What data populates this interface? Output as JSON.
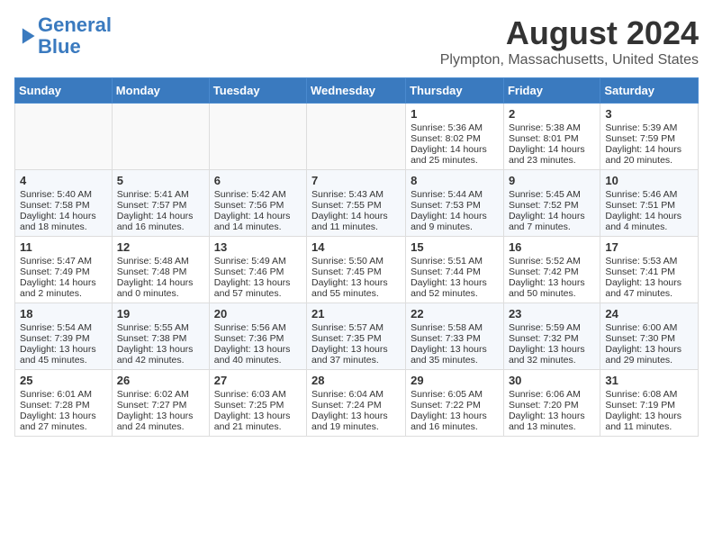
{
  "header": {
    "logo_line1": "General",
    "logo_line2": "Blue",
    "month_title": "August 2024",
    "location": "Plympton, Massachusetts, United States"
  },
  "weekdays": [
    "Sunday",
    "Monday",
    "Tuesday",
    "Wednesday",
    "Thursday",
    "Friday",
    "Saturday"
  ],
  "weeks": [
    [
      {
        "day": "",
        "content": ""
      },
      {
        "day": "",
        "content": ""
      },
      {
        "day": "",
        "content": ""
      },
      {
        "day": "",
        "content": ""
      },
      {
        "day": "1",
        "content": "Sunrise: 5:36 AM\nSunset: 8:02 PM\nDaylight: 14 hours\nand 25 minutes."
      },
      {
        "day": "2",
        "content": "Sunrise: 5:38 AM\nSunset: 8:01 PM\nDaylight: 14 hours\nand 23 minutes."
      },
      {
        "day": "3",
        "content": "Sunrise: 5:39 AM\nSunset: 7:59 PM\nDaylight: 14 hours\nand 20 minutes."
      }
    ],
    [
      {
        "day": "4",
        "content": "Sunrise: 5:40 AM\nSunset: 7:58 PM\nDaylight: 14 hours\nand 18 minutes."
      },
      {
        "day": "5",
        "content": "Sunrise: 5:41 AM\nSunset: 7:57 PM\nDaylight: 14 hours\nand 16 minutes."
      },
      {
        "day": "6",
        "content": "Sunrise: 5:42 AM\nSunset: 7:56 PM\nDaylight: 14 hours\nand 14 minutes."
      },
      {
        "day": "7",
        "content": "Sunrise: 5:43 AM\nSunset: 7:55 PM\nDaylight: 14 hours\nand 11 minutes."
      },
      {
        "day": "8",
        "content": "Sunrise: 5:44 AM\nSunset: 7:53 PM\nDaylight: 14 hours\nand 9 minutes."
      },
      {
        "day": "9",
        "content": "Sunrise: 5:45 AM\nSunset: 7:52 PM\nDaylight: 14 hours\nand 7 minutes."
      },
      {
        "day": "10",
        "content": "Sunrise: 5:46 AM\nSunset: 7:51 PM\nDaylight: 14 hours\nand 4 minutes."
      }
    ],
    [
      {
        "day": "11",
        "content": "Sunrise: 5:47 AM\nSunset: 7:49 PM\nDaylight: 14 hours\nand 2 minutes."
      },
      {
        "day": "12",
        "content": "Sunrise: 5:48 AM\nSunset: 7:48 PM\nDaylight: 14 hours\nand 0 minutes."
      },
      {
        "day": "13",
        "content": "Sunrise: 5:49 AM\nSunset: 7:46 PM\nDaylight: 13 hours\nand 57 minutes."
      },
      {
        "day": "14",
        "content": "Sunrise: 5:50 AM\nSunset: 7:45 PM\nDaylight: 13 hours\nand 55 minutes."
      },
      {
        "day": "15",
        "content": "Sunrise: 5:51 AM\nSunset: 7:44 PM\nDaylight: 13 hours\nand 52 minutes."
      },
      {
        "day": "16",
        "content": "Sunrise: 5:52 AM\nSunset: 7:42 PM\nDaylight: 13 hours\nand 50 minutes."
      },
      {
        "day": "17",
        "content": "Sunrise: 5:53 AM\nSunset: 7:41 PM\nDaylight: 13 hours\nand 47 minutes."
      }
    ],
    [
      {
        "day": "18",
        "content": "Sunrise: 5:54 AM\nSunset: 7:39 PM\nDaylight: 13 hours\nand 45 minutes."
      },
      {
        "day": "19",
        "content": "Sunrise: 5:55 AM\nSunset: 7:38 PM\nDaylight: 13 hours\nand 42 minutes."
      },
      {
        "day": "20",
        "content": "Sunrise: 5:56 AM\nSunset: 7:36 PM\nDaylight: 13 hours\nand 40 minutes."
      },
      {
        "day": "21",
        "content": "Sunrise: 5:57 AM\nSunset: 7:35 PM\nDaylight: 13 hours\nand 37 minutes."
      },
      {
        "day": "22",
        "content": "Sunrise: 5:58 AM\nSunset: 7:33 PM\nDaylight: 13 hours\nand 35 minutes."
      },
      {
        "day": "23",
        "content": "Sunrise: 5:59 AM\nSunset: 7:32 PM\nDaylight: 13 hours\nand 32 minutes."
      },
      {
        "day": "24",
        "content": "Sunrise: 6:00 AM\nSunset: 7:30 PM\nDaylight: 13 hours\nand 29 minutes."
      }
    ],
    [
      {
        "day": "25",
        "content": "Sunrise: 6:01 AM\nSunset: 7:28 PM\nDaylight: 13 hours\nand 27 minutes."
      },
      {
        "day": "26",
        "content": "Sunrise: 6:02 AM\nSunset: 7:27 PM\nDaylight: 13 hours\nand 24 minutes."
      },
      {
        "day": "27",
        "content": "Sunrise: 6:03 AM\nSunset: 7:25 PM\nDaylight: 13 hours\nand 21 minutes."
      },
      {
        "day": "28",
        "content": "Sunrise: 6:04 AM\nSunset: 7:24 PM\nDaylight: 13 hours\nand 19 minutes."
      },
      {
        "day": "29",
        "content": "Sunrise: 6:05 AM\nSunset: 7:22 PM\nDaylight: 13 hours\nand 16 minutes."
      },
      {
        "day": "30",
        "content": "Sunrise: 6:06 AM\nSunset: 7:20 PM\nDaylight: 13 hours\nand 13 minutes."
      },
      {
        "day": "31",
        "content": "Sunrise: 6:08 AM\nSunset: 7:19 PM\nDaylight: 13 hours\nand 11 minutes."
      }
    ]
  ]
}
